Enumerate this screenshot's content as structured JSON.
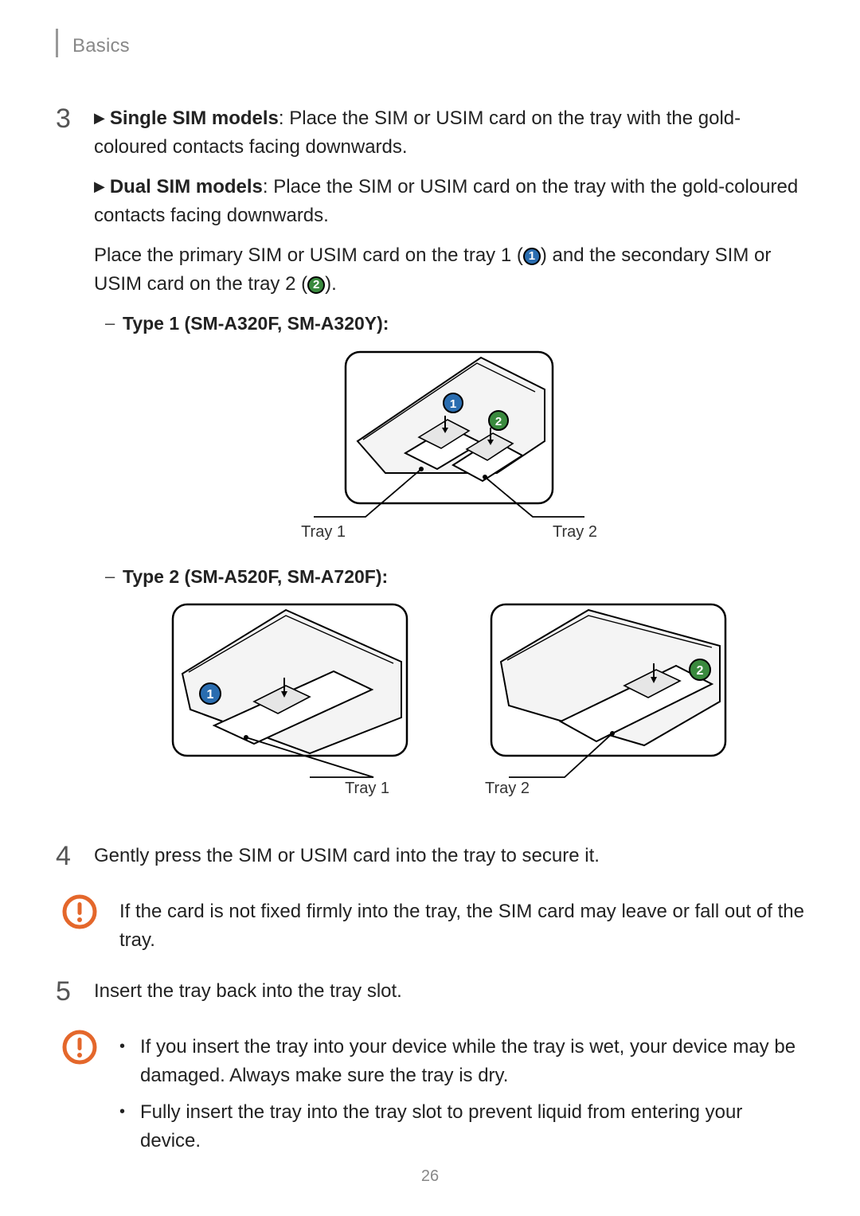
{
  "header": {
    "section": "Basics"
  },
  "page_number": "26",
  "steps": {
    "three": {
      "num": "3",
      "single_bold": "Single SIM models",
      "single_text": ": Place the SIM or USIM card on the tray with the gold-coloured contacts facing downwards.",
      "dual_bold": "Dual SIM models",
      "dual_text": ": Place the SIM or USIM card on the tray with the gold-coloured contacts facing downwards.",
      "place_text_a": "Place the primary SIM or USIM card on the tray 1 (",
      "place_text_b": ") and the secondary SIM or USIM card on the tray 2 (",
      "place_text_c": ").",
      "badge1": "1",
      "badge2": "2",
      "type1_label": "Type 1 (SM-A320F, SM-A320Y):",
      "type2_label": "Type 2 (SM-A520F, SM-A720F):",
      "tray1_label": "Tray 1",
      "tray2_label": "Tray 2"
    },
    "four": {
      "num": "4",
      "text": "Gently press the SIM or USIM card into the tray to secure it.",
      "caution": "If the card is not fixed firmly into the tray, the SIM card may leave or fall out of the tray."
    },
    "five": {
      "num": "5",
      "text": "Insert the tray back into the tray slot.",
      "caution_items": [
        "If you insert the tray into your device while the tray is wet, your device may be damaged. Always make sure the tray is dry.",
        "Fully insert the tray into the tray slot to prevent liquid from entering your device."
      ]
    }
  },
  "icons": {
    "triangle": "▶"
  }
}
